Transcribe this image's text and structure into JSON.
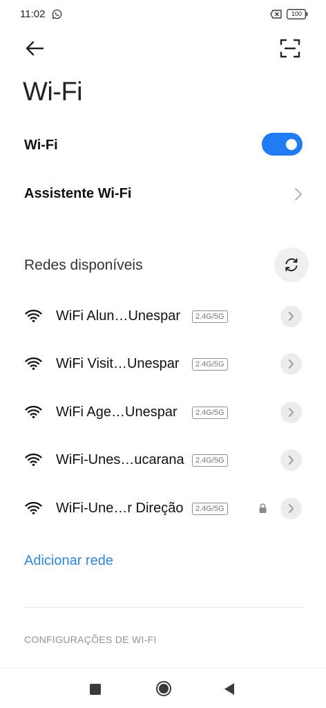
{
  "status_bar": {
    "time": "11:02",
    "battery": "100",
    "icons": [
      "whatsapp-icon",
      "sim-off-icon",
      "battery-icon"
    ]
  },
  "header": {
    "back_icon": "arrow-left-icon",
    "scan_icon": "qr-scan-icon",
    "title": "Wi-Fi"
  },
  "wifi_toggle": {
    "label": "Wi-Fi",
    "enabled": true,
    "accent_color": "#1f7cf2"
  },
  "assistant": {
    "label": "Assistente Wi-Fi"
  },
  "networks_section": {
    "title": "Redes disponíveis",
    "refresh_icon": "refresh-icon",
    "networks": [
      {
        "name": "WiFi Alun…Unespar",
        "band": "2.4G/5G",
        "locked": false
      },
      {
        "name": "WiFi Visit…Unespar",
        "band": "2.4G/5G",
        "locked": false
      },
      {
        "name": "WiFi Age…Unespar",
        "band": "2.4G/5G",
        "locked": false
      },
      {
        "name": "WiFi-Unes…ucarana",
        "band": "2.4G/5G",
        "locked": false
      },
      {
        "name": "WiFi-Une…r Direção",
        "band": "2.4G/5G",
        "locked": true
      }
    ]
  },
  "add_network": {
    "label": "Adicionar rede",
    "color": "#2f86dd"
  },
  "settings": {
    "header": "CONFIGURAÇÕES DE WI-FI"
  },
  "nav_bar": {
    "icons": [
      "recents-icon",
      "home-icon",
      "back-icon"
    ]
  }
}
